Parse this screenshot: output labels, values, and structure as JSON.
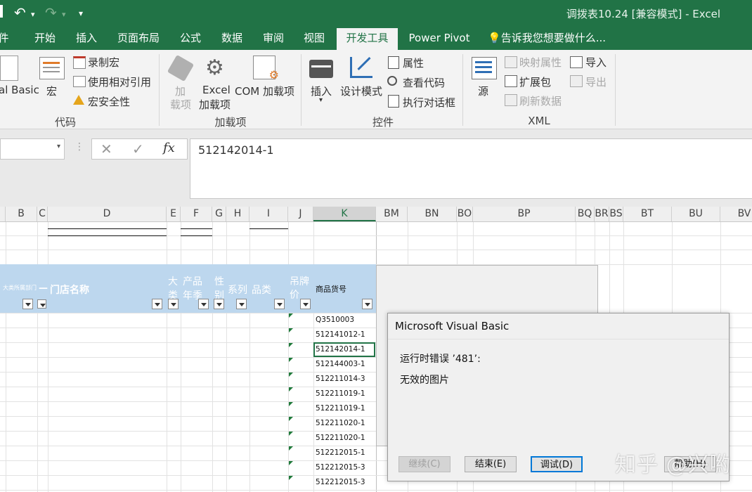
{
  "window": {
    "title": "调拨表10.24  [兼容模式] - Excel"
  },
  "tabs": [
    {
      "label": "件"
    },
    {
      "label": "开始"
    },
    {
      "label": "插入"
    },
    {
      "label": "页面布局"
    },
    {
      "label": "公式"
    },
    {
      "label": "数据"
    },
    {
      "label": "审阅"
    },
    {
      "label": "视图"
    },
    {
      "label": "开发工具"
    },
    {
      "label": "Power Pivot"
    },
    {
      "label": "告诉我您想要做什么..."
    }
  ],
  "ribbon": {
    "code": {
      "group_label": "代码",
      "visual_basic": "al Basic",
      "macros": "宏",
      "record_macro": "录制宏",
      "relative_ref": "使用相对引用",
      "macro_security": "宏安全性"
    },
    "addins": {
      "group_label": "加载项",
      "addins_1": "加",
      "addins_2": "载项",
      "excel_addins_1": "Excel",
      "excel_addins_2": "加载项",
      "com_addins": "COM 加载项"
    },
    "controls": {
      "group_label": "控件",
      "insert": "插入",
      "design_mode": "设计模式",
      "properties": "属性",
      "view_code": "查看代码",
      "run_dialog": "执行对话框"
    },
    "xml": {
      "group_label": "XML",
      "source": "源",
      "map_properties": "映射属性",
      "expansion_packs": "扩展包",
      "refresh_data": "刷新数据",
      "import": "导入",
      "export": "导出"
    }
  },
  "formula_bar": {
    "content": "512142014-1",
    "fx": "fx"
  },
  "columns": [
    "B",
    "C",
    "D",
    "E",
    "F",
    "G",
    "H",
    "I",
    "J",
    "K",
    "BM",
    "BN",
    "BO",
    "BP",
    "BQ",
    "BR",
    "BS",
    "BT",
    "BU",
    "BV"
  ],
  "header_row": {
    "small_header": "大类所属部门",
    "store_name": "门店名称",
    "category_big_1": "大",
    "category_big_2": "类",
    "product_year_1": "产品",
    "product_year_2": "年季",
    "gender_1": "性",
    "gender_2": "别",
    "series": "系列",
    "item_type": "品类",
    "tag_price_1": "吊牌",
    "tag_price_2": "价",
    "sku": "商品货号"
  },
  "sku_cells": [
    "Q3510003",
    "512141012-1",
    "512142014-1",
    "512144003-1",
    "512211014-3",
    "512211019-1",
    "512211019-1",
    "512211020-1",
    "512211020-1",
    "512212015-1",
    "512212015-3",
    "512212015-3"
  ],
  "dialog": {
    "title": "Microsoft Visual Basic",
    "message_1": "运行时错误 ’481’:",
    "message_2": "无效的图片",
    "btn_continue": "继续(C)",
    "btn_end": "结束(E)",
    "btn_debug": "调试(D)",
    "btn_help": "帮助(H)"
  },
  "watermark": "知乎 @兴喲",
  "colors": {
    "excel_green": "#217346",
    "header_blue": "#bdd7ee"
  }
}
